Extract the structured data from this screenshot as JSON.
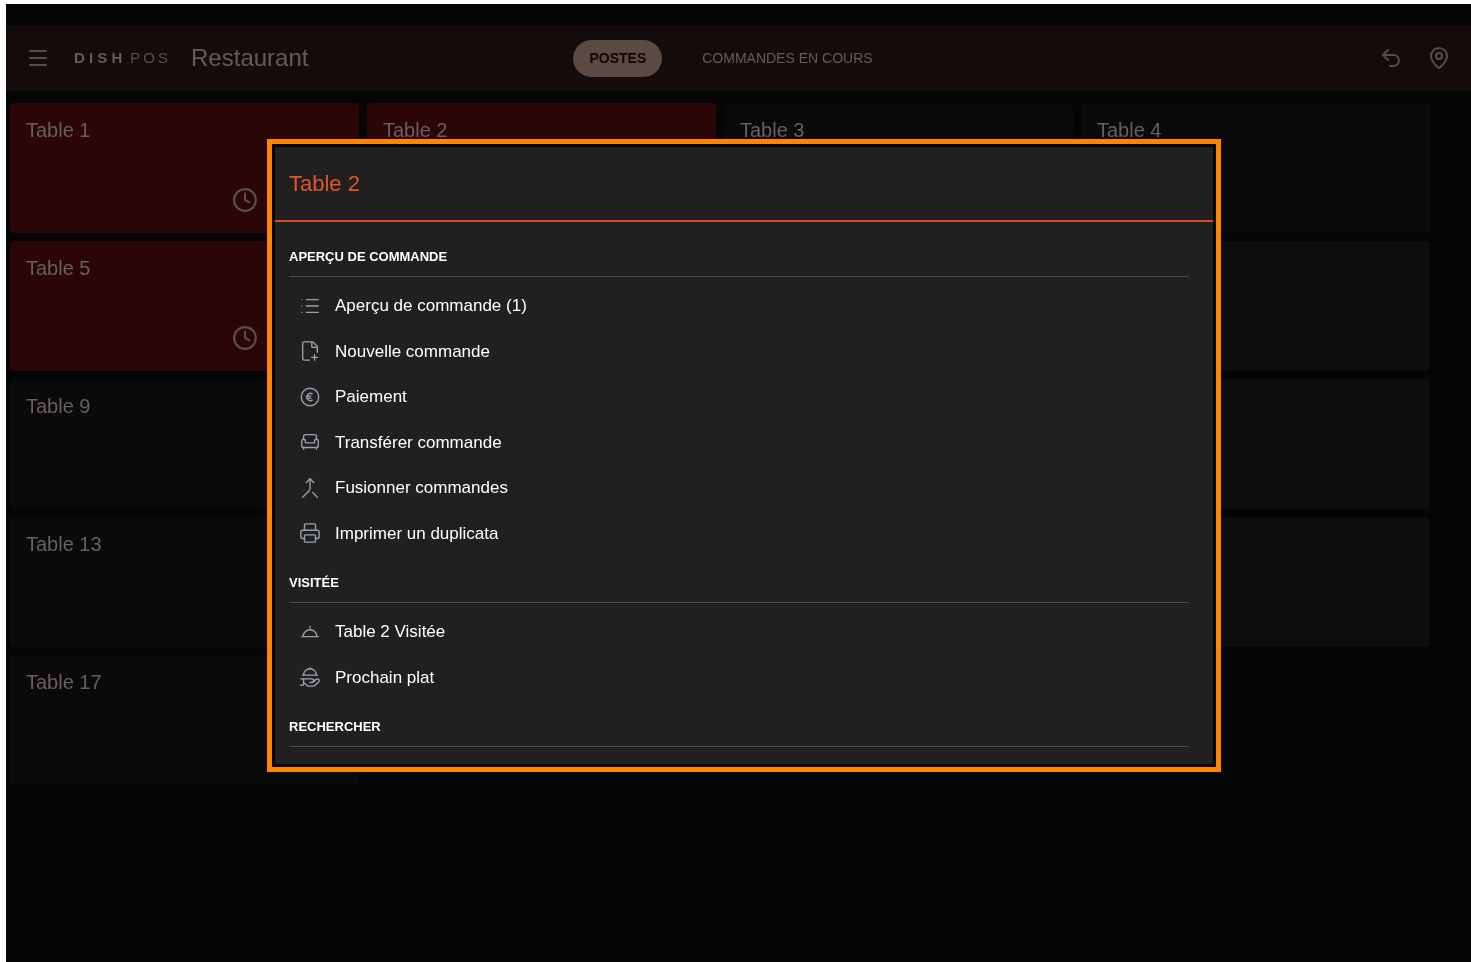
{
  "header": {
    "logo": "D I S H",
    "logo_suffix": "POS",
    "title": "Restaurant",
    "tabs": [
      {
        "label": "POSTES",
        "selected": true
      },
      {
        "label": "COMMANDES EN COURS",
        "selected": false
      }
    ]
  },
  "tables": [
    {
      "label": "Table 1",
      "occupied": true
    },
    {
      "label": "Table 2",
      "occupied": true
    },
    {
      "label": "Table 3",
      "occupied": false
    },
    {
      "label": "Table 4",
      "occupied": false
    },
    {
      "label": "Table 5",
      "occupied": true
    },
    {
      "label": "Table 9",
      "occupied": false
    },
    {
      "label": "Table 13",
      "occupied": false
    },
    {
      "label": "Table 17",
      "occupied": false
    }
  ],
  "dialog": {
    "title": "Table 2",
    "sections": [
      {
        "heading": "APERÇU DE COMMANDE",
        "items": [
          "Aperçu de commande (1)",
          "Nouvelle commande",
          "Paiement",
          "Transférer commande",
          "Fusionner commandes",
          "Imprimer un duplicata"
        ]
      },
      {
        "heading": "VISITÉE",
        "items": [
          "Table 2 Visitée",
          "Prochain plat"
        ]
      },
      {
        "heading": "RECHERCHER"
      }
    ]
  }
}
